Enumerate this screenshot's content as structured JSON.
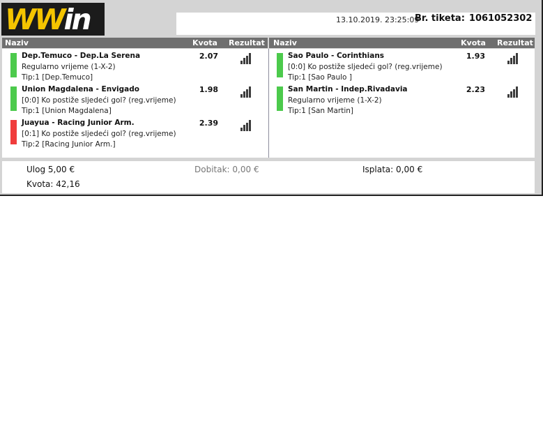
{
  "brand": {
    "logo_text": "WWin",
    "logo_part1": "WW",
    "logo_part2": "in",
    "accent": "#f4c400"
  },
  "ticket": {
    "datetime": "13.10.2019. 23:25:09",
    "number_label": "Br. tiketa:",
    "number": "1061052302"
  },
  "columns": {
    "name": "Naziv",
    "odds": "Kvota",
    "result": "Rezultat"
  },
  "status_colors": {
    "won": "#4cca4c",
    "lost": "#f03c3c"
  },
  "left_bets": [
    {
      "match": "Dep.Temuco - Dep.La Serena",
      "market": "Regularno vrijeme (1-X-2)",
      "tip": "Tip:1 [Dep.Temuco]",
      "odds": "2.07",
      "status": "won",
      "result_icon": "signal-bars-icon"
    },
    {
      "match": "Union Magdalena - Envigado",
      "market": "[0:0] Ko postiže sljedeći gol? (reg.vrijeme)",
      "tip": "Tip:1 [Union Magdalena]",
      "odds": "1.98",
      "status": "won",
      "result_icon": "signal-bars-icon"
    },
    {
      "match": "Juayua - Racing Junior Arm.",
      "market": "[0:1] Ko postiže sljedeći gol? (reg.vrijeme)",
      "tip": "Tip:2 [Racing Junior Arm.]",
      "odds": "2.39",
      "status": "lost",
      "result_icon": "signal-bars-icon"
    }
  ],
  "right_bets": [
    {
      "match": "Sao Paulo - Corinthians",
      "market": "[0:0] Ko postiže sljedeći gol? (reg.vrijeme)",
      "tip": "Tip:1 [Sao Paulo ]",
      "odds": "1.93",
      "status": "won",
      "result_icon": "signal-bars-icon"
    },
    {
      "match": "San Martin - Indep.Rivadavia",
      "market": "Regularno vrijeme (1-X-2)",
      "tip": "Tip:1 [San Martin]",
      "odds": "2.23",
      "status": "won",
      "result_icon": "signal-bars-icon"
    }
  ],
  "summary": {
    "stake_label": "Ulog",
    "stake": "5,00 €",
    "win_label": "Dobitak:",
    "win": "0,00 €",
    "payout_label": "Isplata:",
    "payout": "0,00 €",
    "total_odds_label": "Kvota:",
    "total_odds": "42,16"
  }
}
